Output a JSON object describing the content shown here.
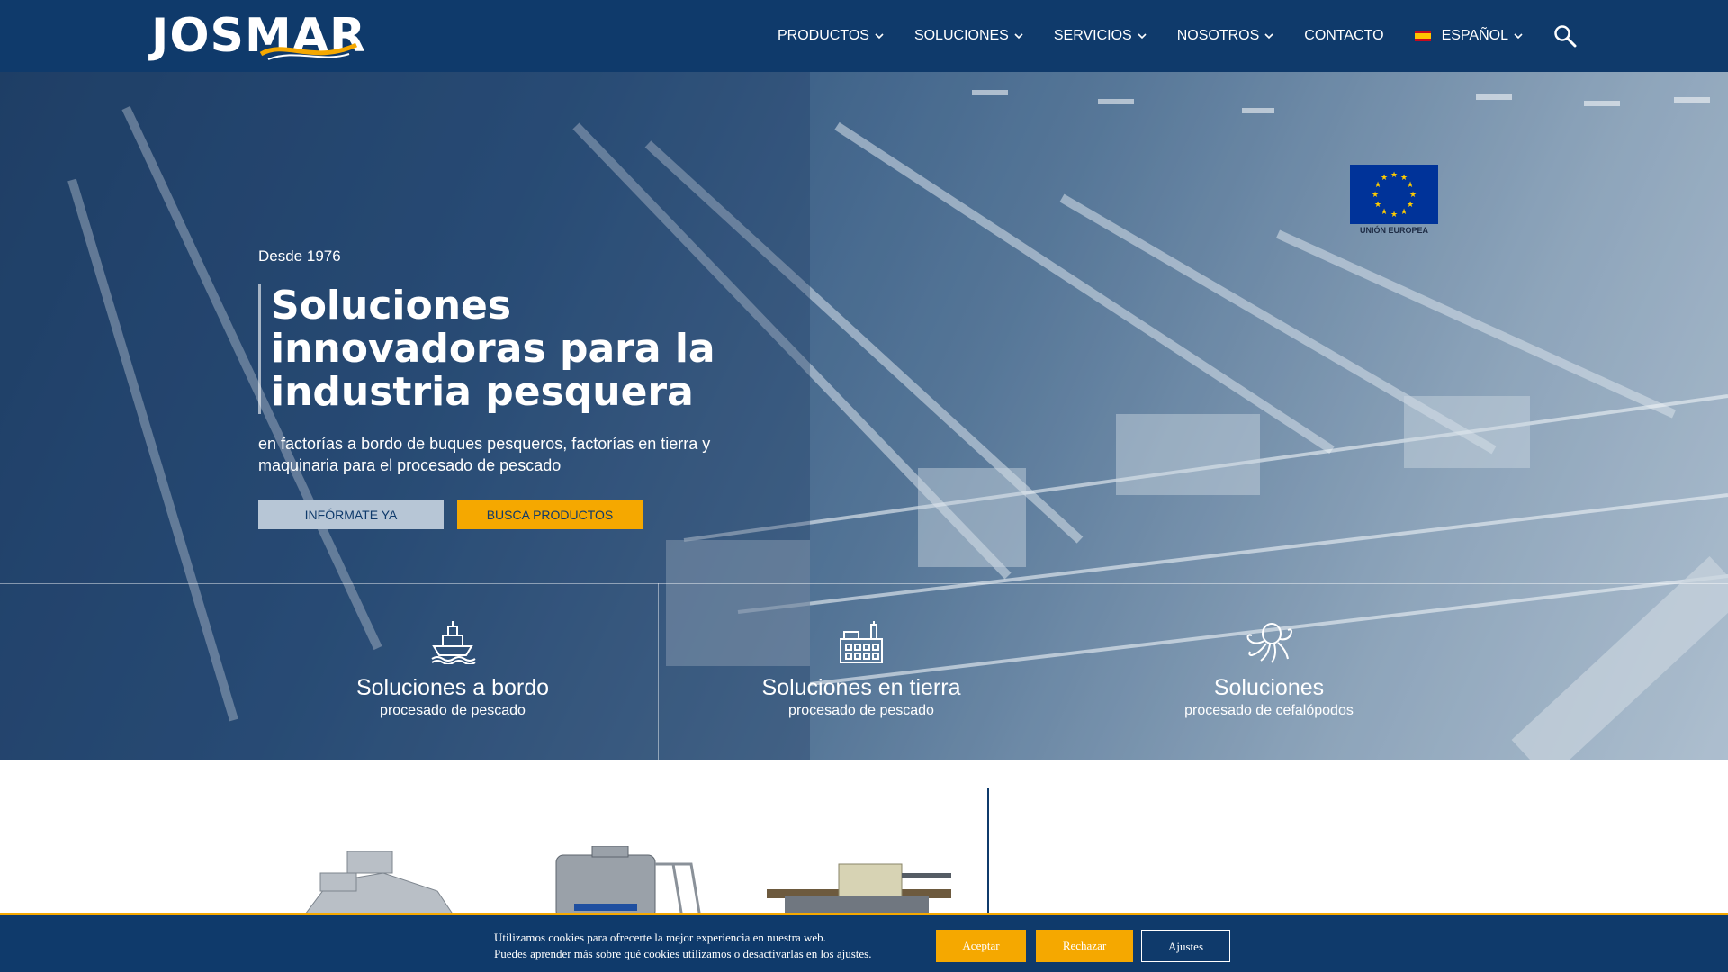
{
  "brand": {
    "logo_text": "JOSMAR"
  },
  "nav": {
    "items": [
      {
        "label": "PRODUCTOS"
      },
      {
        "label": "SOLUCIONES"
      },
      {
        "label": "SERVICIOS"
      },
      {
        "label": "NOSOTROS"
      },
      {
        "label": "CONTACTO"
      }
    ],
    "language": "ESPAÑOL"
  },
  "hero": {
    "eu_label": "UNIÓN EUROPEA",
    "since": "Desde 1976",
    "title": "Soluciones innovadoras para la industria pesquera",
    "subtitle": "en factorías a bordo de buques pesqueros, factorías en tierra y maquinaria para el procesado de pescado",
    "btn_info": "INFÓRMATE YA",
    "btn_search": "BUSCA PRODUCTOS"
  },
  "solutions": [
    {
      "title": "Soluciones a bordo",
      "subtitle": "procesado de pescado",
      "icon": "ship-icon"
    },
    {
      "title": "Soluciones en tierra",
      "subtitle": "procesado de pescado",
      "icon": "factory-icon"
    },
    {
      "title": "Soluciones",
      "subtitle": "procesado de cefalópodos",
      "icon": "octopus-icon"
    }
  ],
  "cookie": {
    "line1": "Utilizamos cookies para ofrecerte la mejor experiencia en nuestra web.",
    "line2_prefix": "Puedes aprender más sobre qué cookies utilizamos o desactivarlas en los ",
    "line2_link": "ajustes",
    "line2_suffix": ".",
    "accept": "Aceptar",
    "reject": "Rechazar",
    "settings": "Ajustes"
  },
  "colors": {
    "primary": "#0f3a6b",
    "accent": "#f5a800",
    "light_button": "#b7c6d6"
  }
}
